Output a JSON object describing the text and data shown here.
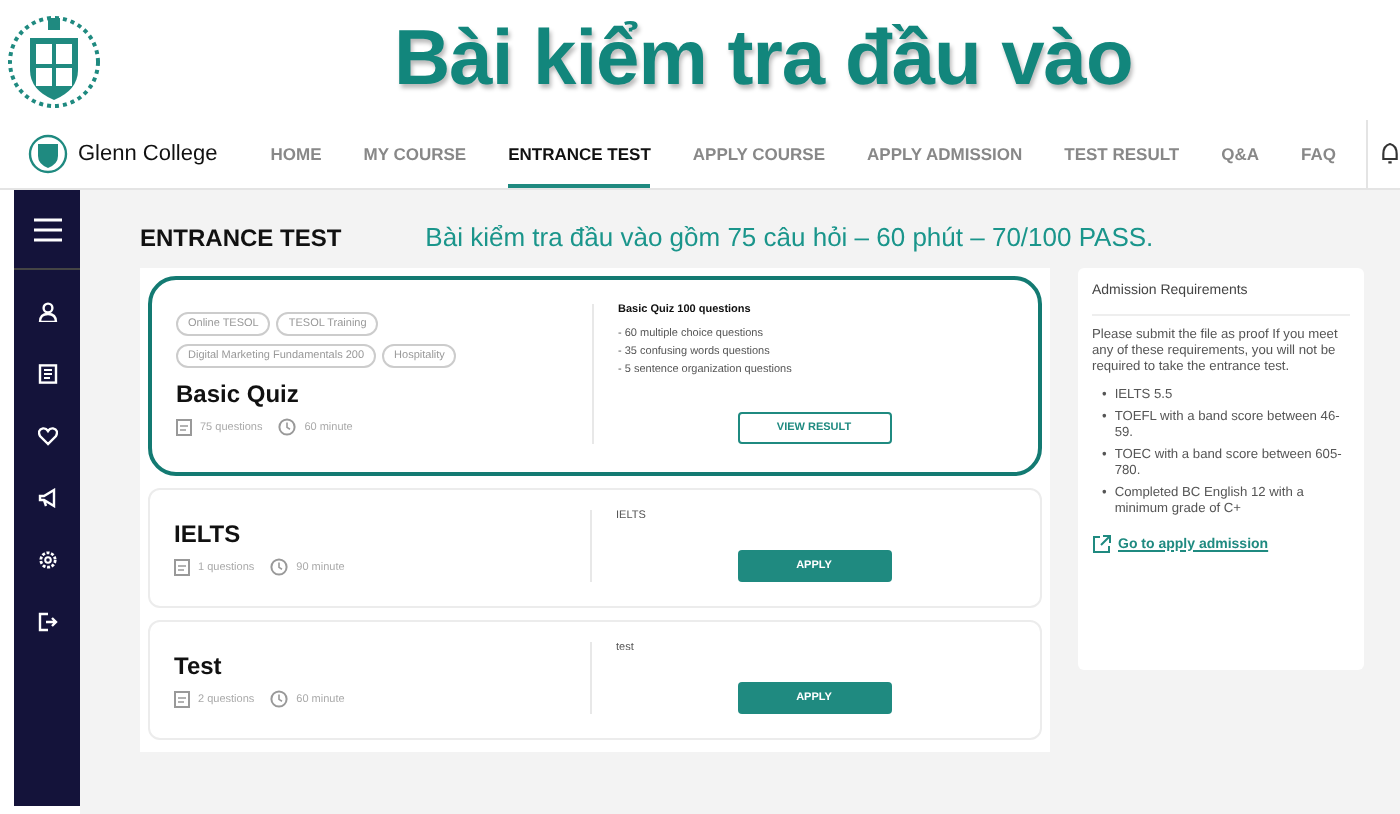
{
  "slide": {
    "title": "Bài kiểm tra đầu vào"
  },
  "nav": {
    "brand": "Glenn College",
    "items": [
      {
        "label": "HOME",
        "selected": false
      },
      {
        "label": "MY COURSE",
        "selected": false
      },
      {
        "label": "ENTRANCE TEST",
        "selected": true
      },
      {
        "label": "APPLY COURSE",
        "selected": false
      },
      {
        "label": "APPLY ADMISSION",
        "selected": false
      },
      {
        "label": "TEST RESULT",
        "selected": false
      },
      {
        "label": "Q&A",
        "selected": false
      },
      {
        "label": "FAQ",
        "selected": false
      }
    ]
  },
  "page": {
    "heading": "ENTRANCE TEST",
    "note": "Bài kiểm tra đầu vào gồm 75 câu hỏi – 60 phút – 70/100 PASS."
  },
  "tests": [
    {
      "tags": [
        "Online TESOL",
        "TESOL Training",
        "Digital Marketing Fundamentals 200",
        "Hospitality"
      ],
      "title": "Basic Quiz",
      "questions": "75 questions",
      "duration": "60 minute",
      "description_title": "Basic Quiz 100 questions",
      "description_lines": [
        "- 60 multiple choice questions",
        "- 35 confusing words questions",
        "- 5 sentence organization questions"
      ],
      "button": {
        "label": "VIEW RESULT",
        "kind": "outline"
      },
      "highlighted": true
    },
    {
      "title": "IELTS",
      "questions": "1 questions",
      "duration": "90 minute",
      "description_title": "IELTS",
      "button": {
        "label": "APPLY",
        "kind": "filled"
      },
      "highlighted": false
    },
    {
      "title": "Test",
      "questions": "2 questions",
      "duration": "60 minute",
      "description_title": "test",
      "button": {
        "label": "APPLY",
        "kind": "filled"
      },
      "highlighted": false
    }
  ],
  "requirements": {
    "title": "Admission Requirements",
    "intro": "Please submit the file as proof If you meet any of these requirements, you will not be required to take the entrance test.",
    "bullet": "•",
    "items": [
      "IELTS 5.5",
      "TOEFL with a band score between 46-59.",
      "TOEC with a band score between 605-780.",
      "Completed BC English 12 with a minimum grade of C+"
    ],
    "link": "Go to apply admission"
  }
}
